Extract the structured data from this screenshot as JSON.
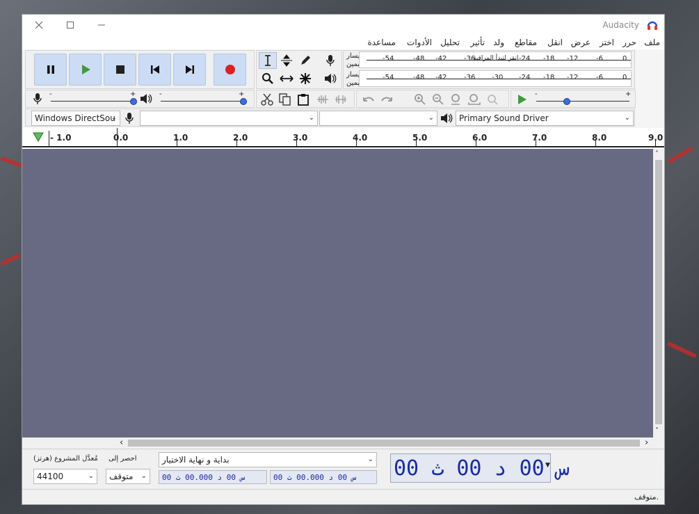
{
  "window": {
    "title": "Audacity"
  },
  "menu": [
    "ملف",
    "حرر",
    "اختز",
    "عرض",
    "انقل",
    "مقاطع",
    "ولد",
    "تأثير",
    "تحليل",
    "الأدوات",
    "مساعدة"
  ],
  "meters": {
    "record_channel_top": "يسار",
    "record_channel_bottom": "يمين",
    "play_channel_top": "يسار",
    "play_channel_bottom": "يمين",
    "record_monitor_text": "انقر لتبدأ المراقبة",
    "record_scale": [
      "-54",
      "-48",
      "-42",
      "-36",
      "-24",
      "-18",
      "-12",
      "-6",
      "0"
    ],
    "play_scale": [
      "-54",
      "-48",
      "-42",
      "-36",
      "-30",
      "-24",
      "-18",
      "-12",
      "-6",
      "0"
    ]
  },
  "sliders": {
    "minus": "-",
    "plus": "+"
  },
  "devices": {
    "host": "Windows DirectSou",
    "recording_device": "",
    "channels": "",
    "playback_device": "Primary Sound Driver"
  },
  "ruler": {
    "labels": [
      "- 1.0",
      "0.0",
      "1.0",
      "2.0",
      "3.0",
      "4.0",
      "5.0",
      "6.0",
      "7.0",
      "8.0",
      "9.0"
    ]
  },
  "scroll": {
    "left": "‹",
    "right": "›",
    "up": "˄",
    "down": "˅"
  },
  "selection_bar": {
    "rate_label": "مُعدَّل المشروع (هرتز)",
    "rate_value": "44100",
    "snap_label": "احصر إلى",
    "snap_value": "متوقف",
    "selection_mode": "بداية و نهاية الاختيار",
    "start_time": "00 س 00 د 00.000 ث",
    "end_time": "00 س 00 د 00.000 ث"
  },
  "big_time": {
    "text": "00 س 00 د 00 ث"
  },
  "status": {
    "text": "متوقف."
  },
  "colors": {
    "accent": "#3a6de0",
    "track_bg": "#676a82",
    "record": "#e02020",
    "play": "#3d9b3d",
    "time_text": "#1a2ca0"
  }
}
